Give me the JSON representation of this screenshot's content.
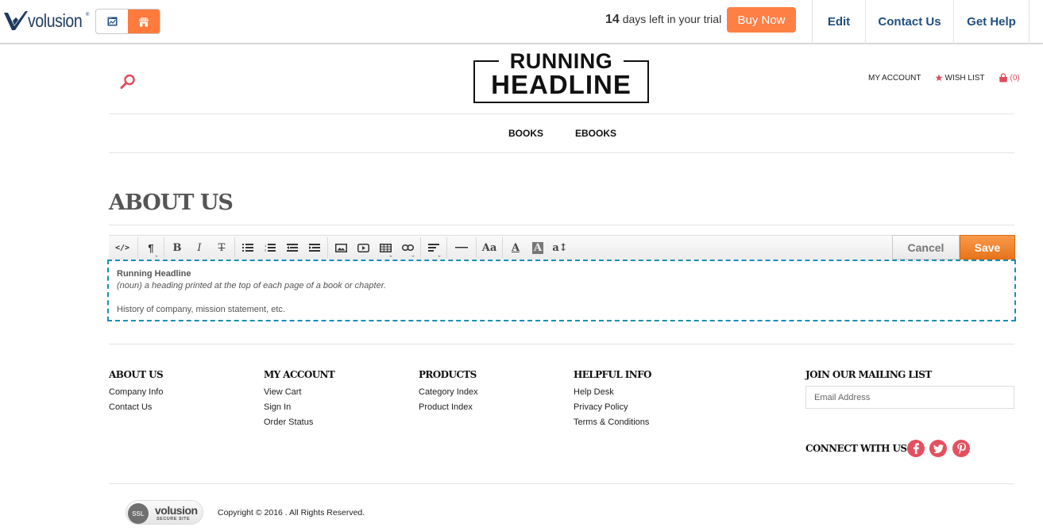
{
  "admin_bar": {
    "brand": "volusion",
    "brand_mark": "®",
    "mode_toggle": [
      {
        "name": "dashboard",
        "icon": "chart-window-icon",
        "active": false
      },
      {
        "name": "store-design",
        "icon": "storefront-icon",
        "active": true
      }
    ],
    "trial": {
      "days": "14",
      "text": "days left in your trial"
    },
    "buy_now_label": "Buy Now",
    "nav": [
      {
        "label": "Edit"
      },
      {
        "label": "Contact Us"
      },
      {
        "label": "Get Help"
      }
    ],
    "colors": {
      "accent": "#ff7f45",
      "link": "#1f4f7f"
    }
  },
  "store_header": {
    "logo": {
      "line1": "RUNNING",
      "line2": "HEADLINE"
    },
    "search_icon": "search-icon",
    "account_links": {
      "my_account": "MY ACCOUNT",
      "wish_list": "WISH LIST",
      "cart_count": "(0)"
    },
    "nav": [
      {
        "label": "BOOKS"
      },
      {
        "label": "EBOOKS"
      }
    ],
    "colors": {
      "icon": "#e04a5a"
    }
  },
  "page": {
    "title": "ABOUT US"
  },
  "editor": {
    "toolbar": [
      {
        "name": "html-code",
        "glyph": "</>"
      },
      {
        "name": "paragraph-format",
        "glyph": "¶"
      },
      {
        "name": "bold",
        "glyph": "B"
      },
      {
        "name": "italic",
        "glyph": "I"
      },
      {
        "name": "strikethrough",
        "glyph": "T"
      },
      {
        "name": "unordered-list"
      },
      {
        "name": "ordered-list"
      },
      {
        "name": "outdent"
      },
      {
        "name": "indent"
      },
      {
        "name": "insert-image"
      },
      {
        "name": "insert-video"
      },
      {
        "name": "insert-table"
      },
      {
        "name": "insert-link"
      },
      {
        "name": "align"
      },
      {
        "name": "horizontal-rule",
        "glyph": "—"
      },
      {
        "name": "font-family",
        "glyph": "Aa"
      },
      {
        "name": "text-color",
        "glyph": "A"
      },
      {
        "name": "background-color",
        "glyph": "A"
      },
      {
        "name": "font-size",
        "glyph": "a↕"
      }
    ],
    "cancel_label": "Cancel",
    "save_label": "Save",
    "content": {
      "heading": "Running Headline",
      "definition": "(noun) a heading printed at the top of each page of a book or chapter.",
      "paragraph": "History of company, mission statement, etc."
    },
    "colors": {
      "border": "#1a8fb5",
      "save": "#f08a30"
    }
  },
  "footer": {
    "columns": [
      {
        "heading": "ABOUT US",
        "links": [
          "Company Info",
          "Contact Us"
        ]
      },
      {
        "heading": "MY ACCOUNT",
        "links": [
          "View Cart",
          "Sign In",
          "Order Status"
        ]
      },
      {
        "heading": "PRODUCTS",
        "links": [
          "Category Index",
          "Product Index"
        ]
      },
      {
        "heading": "HELPFUL INFO",
        "links": [
          "Help Desk",
          "Privacy Policy",
          "Terms & Conditions"
        ]
      }
    ],
    "mailing": {
      "heading": "JOIN OUR MAILING LIST",
      "placeholder": "Email Address"
    },
    "connect": {
      "label": "CONNECT WITH US!",
      "networks": [
        "facebook",
        "twitter",
        "pinterest"
      ]
    },
    "ssl_badge": {
      "badge": "SSL",
      "brand": "volusion",
      "subtitle": "SECURE SITE"
    },
    "copyright": "Copyright © 2016 . All Rights Reserved."
  }
}
